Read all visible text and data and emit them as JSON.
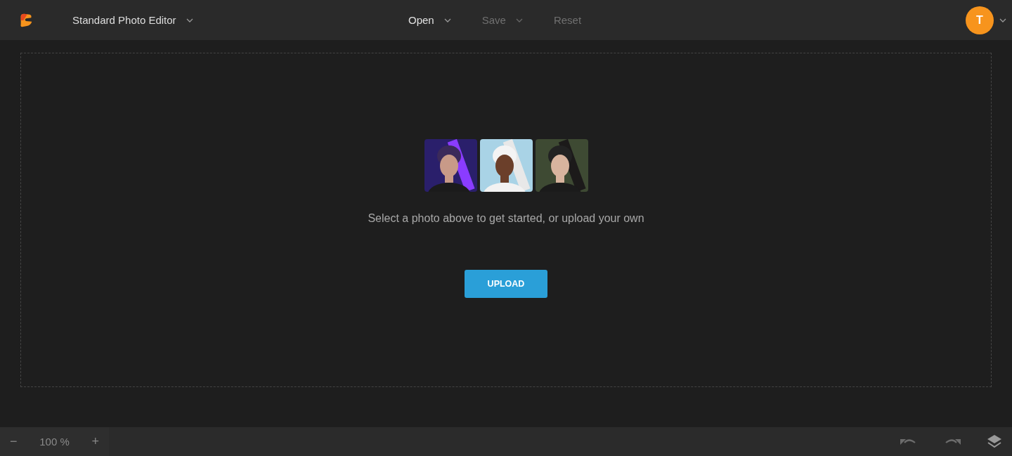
{
  "app": {
    "title": "Standard Photo Editor"
  },
  "menu": [
    {
      "label": "Open",
      "disabled": false,
      "has_dropdown": true
    },
    {
      "label": "Save",
      "disabled": true,
      "has_dropdown": true
    },
    {
      "label": "Reset",
      "disabled": true,
      "has_dropdown": false
    }
  ],
  "user": {
    "initial": "T"
  },
  "prompt": "Select a photo above to get started, or upload your own",
  "upload_button": "UPLOAD",
  "zoom": {
    "minus": "−",
    "value": "100 %",
    "plus": "+"
  },
  "history": {
    "undo_disabled": true,
    "redo_disabled": true
  }
}
